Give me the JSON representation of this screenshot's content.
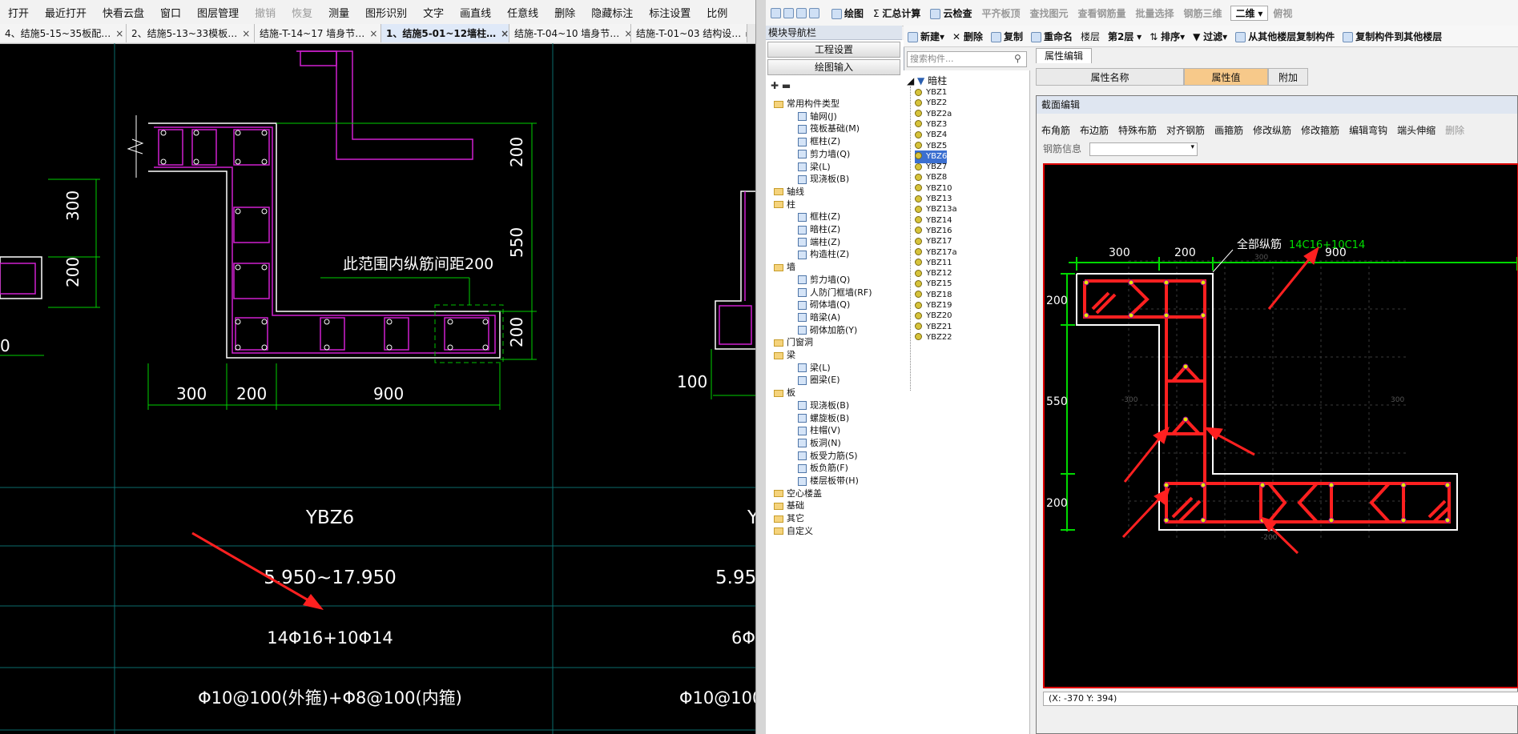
{
  "left_cad": {
    "menu": [
      "打开",
      "最近打开",
      "快看云盘",
      "窗口",
      "图层管理",
      "撤销",
      "恢复",
      "测量",
      "图形识别",
      "文字",
      "画直线",
      "任意线",
      "删除",
      "隐藏标注",
      "标注设置",
      "比例"
    ],
    "menu_disabled": [
      "撤销",
      "恢复"
    ],
    "tabs": [
      "4、结施5-15~35板配…",
      "2、结施5-13~33模板…",
      "结施-T-14~17 墙身节…",
      "1、结施5-01~12墙柱…",
      "结施-T-04~10 墙身节…",
      "结施-T-01~03 结构设…"
    ],
    "active_tab": 3,
    "drawing": {
      "dims_left": [
        "300",
        "200"
      ],
      "dims_right": [
        "200",
        "550",
        "200"
      ],
      "dims_bottom": [
        "300",
        "200",
        "900"
      ],
      "note": "此范围内纵筋间距200",
      "side_dim": "100",
      "left_cut_dim": "0"
    },
    "table": {
      "col1": [
        "YBZ6",
        "5.950~17.950",
        "14Φ16+10Φ14",
        "Φ10@100(外箍)+Φ8@100(内箍)"
      ],
      "col2": [
        "Y",
        "5.95",
        "6Φ",
        "Φ10@100("
      ]
    }
  },
  "right_app": {
    "toolbar1": [
      "绘图",
      "汇总计算",
      "云检查",
      "平齐板顶",
      "查找图元",
      "查看钢筋量",
      "批量选择",
      "钢筋三维",
      "二维",
      "俯视"
    ],
    "toolbar1_disabled": [
      "平齐板顶",
      "查找图元",
      "查看钢筋量",
      "批量选择",
      "钢筋三维"
    ],
    "nav_title": "模块导航栏",
    "nav_buttons": [
      "工程设置",
      "绘图输入"
    ],
    "nav_tree": [
      {
        "label": "常用构件类型",
        "level": 1,
        "folder": true
      },
      {
        "label": "轴网(J)",
        "level": 2
      },
      {
        "label": "筏板基础(M)",
        "level": 2
      },
      {
        "label": "框柱(Z)",
        "level": 2
      },
      {
        "label": "剪力墙(Q)",
        "level": 2
      },
      {
        "label": "梁(L)",
        "level": 2
      },
      {
        "label": "现浇板(B)",
        "level": 2
      },
      {
        "label": "轴线",
        "level": 1,
        "folder": true
      },
      {
        "label": "柱",
        "level": 1,
        "folder": true
      },
      {
        "label": "框柱(Z)",
        "level": 2
      },
      {
        "label": "暗柱(Z)",
        "level": 2
      },
      {
        "label": "端柱(Z)",
        "level": 2
      },
      {
        "label": "构造柱(Z)",
        "level": 2
      },
      {
        "label": "墙",
        "level": 1,
        "folder": true
      },
      {
        "label": "剪力墙(Q)",
        "level": 2
      },
      {
        "label": "人防门框墙(RF)",
        "level": 2
      },
      {
        "label": "砌体墙(Q)",
        "level": 2
      },
      {
        "label": "暗梁(A)",
        "level": 2
      },
      {
        "label": "砌体加筋(Y)",
        "level": 2
      },
      {
        "label": "门窗洞",
        "level": 1,
        "folder": true
      },
      {
        "label": "梁",
        "level": 1,
        "folder": true
      },
      {
        "label": "梁(L)",
        "level": 2
      },
      {
        "label": "圈梁(E)",
        "level": 2
      },
      {
        "label": "板",
        "level": 1,
        "folder": true
      },
      {
        "label": "现浇板(B)",
        "level": 2
      },
      {
        "label": "螺旋板(B)",
        "level": 2
      },
      {
        "label": "柱帽(V)",
        "level": 2
      },
      {
        "label": "板洞(N)",
        "level": 2
      },
      {
        "label": "板受力筋(S)",
        "level": 2
      },
      {
        "label": "板负筋(F)",
        "level": 2
      },
      {
        "label": "楼层板带(H)",
        "level": 2
      },
      {
        "label": "空心楼盖",
        "level": 1,
        "folder": true
      },
      {
        "label": "基础",
        "level": 1,
        "folder": true
      },
      {
        "label": "其它",
        "level": 1,
        "folder": true
      },
      {
        "label": "自定义",
        "level": 1,
        "folder": true
      }
    ],
    "toolbar2": [
      "新建",
      "删除",
      "复制",
      "重命名",
      "楼层",
      "第2层",
      "排序",
      "过滤",
      "从其他楼层复制构件",
      "复制构件到其他楼层"
    ],
    "search_placeholder": "搜索构件...",
    "component_root": "暗柱",
    "components": [
      "YBZ1",
      "YBZ2",
      "YBZ2a",
      "YBZ3",
      "YBZ4",
      "YBZ5",
      "YBZ6",
      "YBZ7",
      "YBZ8",
      "YBZ10",
      "YBZ13",
      "YBZ13a",
      "YBZ14",
      "YBZ16",
      "YBZ17",
      "YBZ17a",
      "YBZ11",
      "YBZ12",
      "YBZ15",
      "YBZ18",
      "YBZ19",
      "YBZ20",
      "YBZ21",
      "YBZ22"
    ],
    "selected_component": "YBZ6",
    "prop_tab": "属性编辑",
    "prop_headers": [
      "属性名称",
      "属性值",
      "附加"
    ],
    "dialog": {
      "title": "截面编辑",
      "tools": [
        "布角筋",
        "布边筋",
        "特殊布筋",
        "对齐钢筋",
        "画箍筋",
        "修改纵筋",
        "修改箍筋",
        "编辑弯钩",
        "端头伸缩",
        "删除"
      ],
      "tools_disabled": [
        "删除"
      ],
      "info_label": "钢筋信息",
      "dims_top": [
        "300",
        "200",
        "900"
      ],
      "dims_left": [
        "200",
        "550",
        "200"
      ],
      "grid_labels": [
        "300",
        "-300",
        "300",
        "-200",
        "-200"
      ],
      "rebar_label": "全部纵筋",
      "rebar_value": "14C16+10C14",
      "status": "(X: -370 Y: 394)"
    }
  },
  "colors": {
    "accent_red": "#ff2020",
    "rebar_green": "#00d800",
    "wall_magenta": "#d020d0",
    "white": "#ffffff"
  }
}
